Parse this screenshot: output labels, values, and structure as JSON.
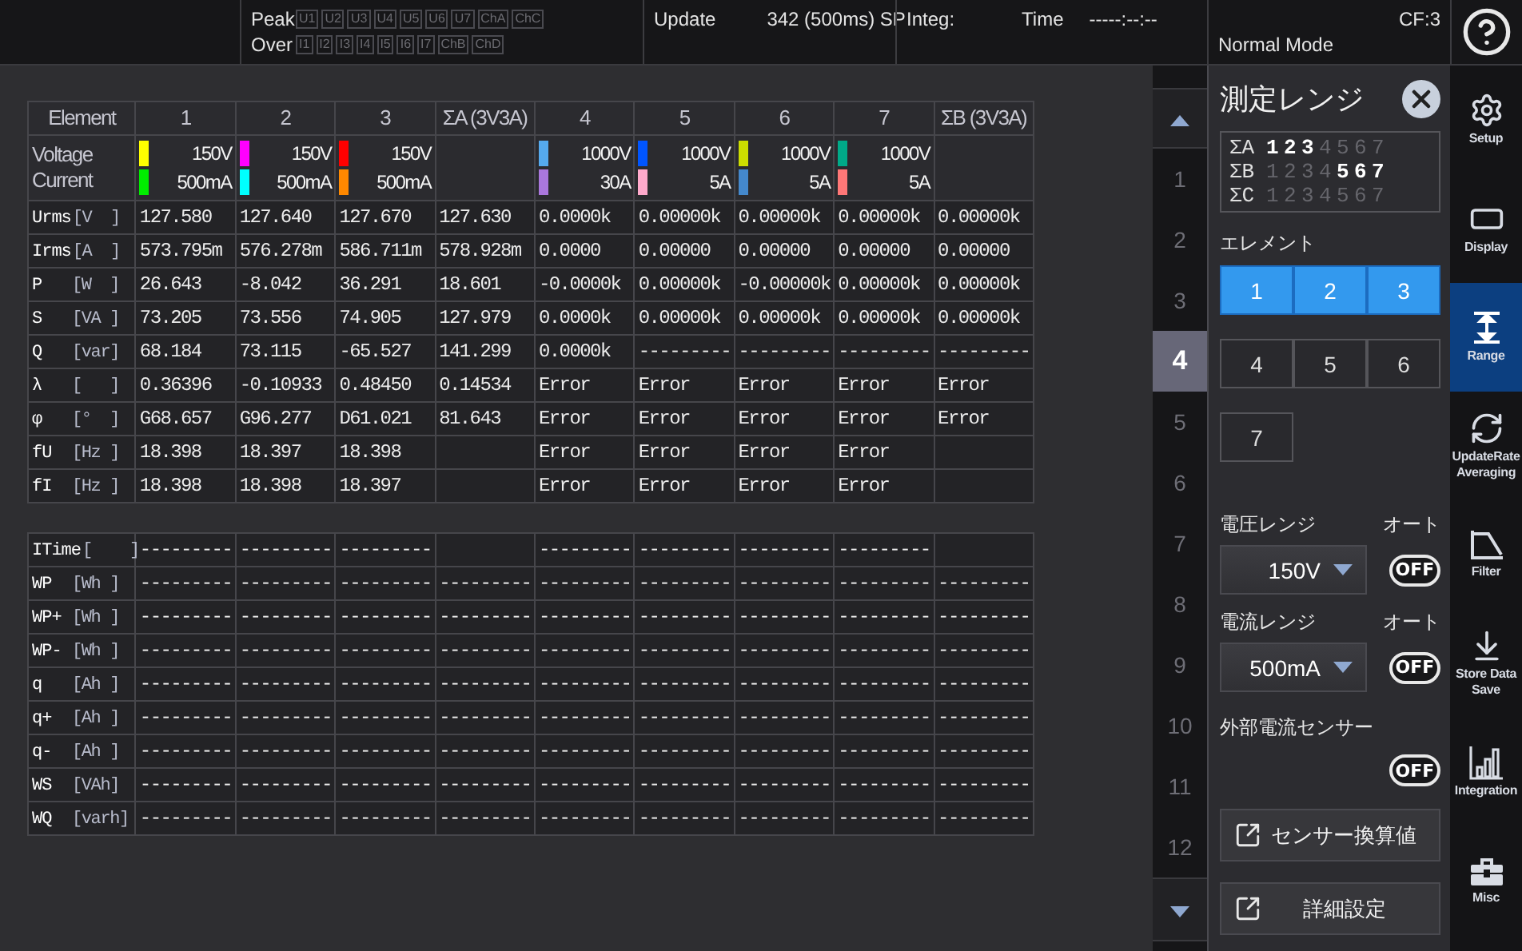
{
  "header": {
    "peak_label": "Peak",
    "peak_indicators": [
      "U1",
      "U2",
      "U3",
      "U4",
      "U5",
      "U6",
      "U7",
      "ChA",
      "ChC"
    ],
    "over_label": "Over",
    "over_indicators": [
      "I1",
      "I2",
      "I3",
      "I4",
      "I5",
      "I6",
      "I7",
      "ChB",
      "ChD"
    ],
    "update_label": "Update",
    "update_value": "342 (500ms) SP",
    "integ_label": "Integ:",
    "time_label": "Time",
    "time_value": "-----:--:--",
    "crest_factor": "CF:3",
    "mode": "Normal Mode"
  },
  "measurement_table": {
    "corner": "Element",
    "range_labels": [
      "Voltage",
      "Current"
    ],
    "columns": [
      {
        "label": "1",
        "voltage": {
          "range": "150V",
          "color": "#ffff00"
        },
        "current": {
          "range": "500mA",
          "color": "#00ee00"
        }
      },
      {
        "label": "2",
        "voltage": {
          "range": "150V",
          "color": "#ff00ff"
        },
        "current": {
          "range": "500mA",
          "color": "#00ffff"
        }
      },
      {
        "label": "3",
        "voltage": {
          "range": "150V",
          "color": "#ff0000"
        },
        "current": {
          "range": "500mA",
          "color": "#ff8800"
        }
      },
      {
        "label": "ΣA (3V3A)"
      },
      {
        "label": "4",
        "voltage": {
          "range": "1000V",
          "color": "#55aaee"
        },
        "current": {
          "range": "30A",
          "color": "#aa77dd"
        }
      },
      {
        "label": "5",
        "voltage": {
          "range": "1000V",
          "color": "#0055ff"
        },
        "current": {
          "range": "5A",
          "color": "#ffaacc"
        }
      },
      {
        "label": "6",
        "voltage": {
          "range": "1000V",
          "color": "#ccdd00"
        },
        "current": {
          "range": "5A",
          "color": "#4488cc"
        }
      },
      {
        "label": "7",
        "voltage": {
          "range": "1000V",
          "color": "#00aa88"
        },
        "current": {
          "range": "5A",
          "color": "#ff7777"
        }
      },
      {
        "label": "ΣB (3V3A)"
      }
    ],
    "rows": [
      {
        "function": "Urms",
        "unit": "[V  ]",
        "cells": [
          {
            "kind": "value",
            "text": "127.580"
          },
          {
            "kind": "value",
            "text": "127.640"
          },
          {
            "kind": "value",
            "text": "127.670"
          },
          {
            "kind": "value",
            "text": "127.630"
          },
          {
            "kind": "value",
            "text": "0.0000k"
          },
          {
            "kind": "value",
            "text": "0.00000k"
          },
          {
            "kind": "value",
            "text": "0.00000k"
          },
          {
            "kind": "value",
            "text": "0.00000k"
          },
          {
            "kind": "value",
            "text": "0.00000k"
          }
        ]
      },
      {
        "function": "Irms",
        "unit": "[A  ]",
        "cells": [
          {
            "kind": "value",
            "text": "573.795m"
          },
          {
            "kind": "value",
            "text": "576.278m"
          },
          {
            "kind": "value",
            "text": "586.711m"
          },
          {
            "kind": "value",
            "text": "578.928m"
          },
          {
            "kind": "value",
            "text": "0.0000"
          },
          {
            "kind": "value",
            "text": "0.00000"
          },
          {
            "kind": "value",
            "text": "0.00000"
          },
          {
            "kind": "value",
            "text": "0.00000"
          },
          {
            "kind": "value",
            "text": "0.00000"
          }
        ]
      },
      {
        "function": "P",
        "unit": "[W  ]",
        "cells": [
          {
            "kind": "value",
            "text": "26.643"
          },
          {
            "kind": "value",
            "text": "-8.042"
          },
          {
            "kind": "value",
            "text": "36.291"
          },
          {
            "kind": "value",
            "text": "18.601"
          },
          {
            "kind": "value",
            "text": "-0.0000k"
          },
          {
            "kind": "value",
            "text": "0.00000k"
          },
          {
            "kind": "value",
            "text": "-0.00000k"
          },
          {
            "kind": "value",
            "text": "0.00000k"
          },
          {
            "kind": "value",
            "text": "0.00000k"
          }
        ]
      },
      {
        "function": "S",
        "unit": "[VA ]",
        "cells": [
          {
            "kind": "value",
            "text": "73.205"
          },
          {
            "kind": "value",
            "text": "73.556"
          },
          {
            "kind": "value",
            "text": "74.905"
          },
          {
            "kind": "value",
            "text": "127.979"
          },
          {
            "kind": "value",
            "text": "0.0000k"
          },
          {
            "kind": "value",
            "text": "0.00000k"
          },
          {
            "kind": "value",
            "text": "0.00000k"
          },
          {
            "kind": "value",
            "text": "0.00000k"
          },
          {
            "kind": "value",
            "text": "0.00000k"
          }
        ]
      },
      {
        "function": "Q",
        "unit": "[var]",
        "cells": [
          {
            "kind": "value",
            "text": "68.184"
          },
          {
            "kind": "value",
            "text": "73.115"
          },
          {
            "kind": "value",
            "text": "-65.527"
          },
          {
            "kind": "value",
            "text": "141.299"
          },
          {
            "kind": "value",
            "text": "0.0000k"
          },
          {
            "kind": "value",
            "text": "---------"
          },
          {
            "kind": "value",
            "text": "---------"
          },
          {
            "kind": "value",
            "text": "---------"
          },
          {
            "kind": "value",
            "text": "---------"
          }
        ]
      },
      {
        "function": "λ",
        "unit": "[   ]",
        "cells": [
          {
            "kind": "value",
            "text": "0.36396"
          },
          {
            "kind": "value",
            "text": "-0.10933"
          },
          {
            "kind": "value",
            "text": "0.48450"
          },
          {
            "kind": "value",
            "text": "0.14534"
          },
          {
            "kind": "value",
            "text": "Error"
          },
          {
            "kind": "value",
            "text": "Error"
          },
          {
            "kind": "value",
            "text": "Error"
          },
          {
            "kind": "value",
            "text": "Error"
          },
          {
            "kind": "value",
            "text": "Error"
          }
        ]
      },
      {
        "function": "φ",
        "unit": "[°  ]",
        "cells": [
          {
            "kind": "value",
            "text": "G68.657"
          },
          {
            "kind": "value",
            "text": "G96.277"
          },
          {
            "kind": "value",
            "text": "D61.021"
          },
          {
            "kind": "value",
            "text": "81.643"
          },
          {
            "kind": "value",
            "text": "Error"
          },
          {
            "kind": "value",
            "text": "Error"
          },
          {
            "kind": "value",
            "text": "Error"
          },
          {
            "kind": "value",
            "text": "Error"
          },
          {
            "kind": "value",
            "text": "Error"
          }
        ]
      },
      {
        "function": "fU",
        "unit": "[Hz ]",
        "cells": [
          {
            "kind": "value",
            "text": "18.398"
          },
          {
            "kind": "value",
            "text": "18.397"
          },
          {
            "kind": "value",
            "text": "18.398"
          },
          {
            "kind": "blank"
          },
          {
            "kind": "value",
            "text": "Error"
          },
          {
            "kind": "value",
            "text": "Error"
          },
          {
            "kind": "value",
            "text": "Error"
          },
          {
            "kind": "value",
            "text": "Error"
          },
          {
            "kind": "blank"
          }
        ]
      },
      {
        "function": "fI",
        "unit": "[Hz ]",
        "cells": [
          {
            "kind": "value",
            "text": "18.398"
          },
          {
            "kind": "value",
            "text": "18.398"
          },
          {
            "kind": "value",
            "text": "18.397"
          },
          {
            "kind": "blank"
          },
          {
            "kind": "value",
            "text": "Error"
          },
          {
            "kind": "value",
            "text": "Error"
          },
          {
            "kind": "value",
            "text": "Error"
          },
          {
            "kind": "value",
            "text": "Error"
          },
          {
            "kind": "blank"
          }
        ]
      }
    ]
  },
  "integration_table": {
    "rows": [
      {
        "function": "ITime",
        "unit": "[    ]",
        "cells": [
          {
            "kind": "value",
            "text": "---------"
          },
          {
            "kind": "value",
            "text": "---------"
          },
          {
            "kind": "value",
            "text": "---------"
          },
          {
            "kind": "blank"
          },
          {
            "kind": "value",
            "text": "---------"
          },
          {
            "kind": "value",
            "text": "---------"
          },
          {
            "kind": "value",
            "text": "---------"
          },
          {
            "kind": "value",
            "text": "---------"
          },
          {
            "kind": "blank"
          }
        ]
      },
      {
        "function": "WP",
        "unit": "[Wh ]",
        "cells": [
          {
            "kind": "value",
            "text": "---------"
          },
          {
            "kind": "value",
            "text": "---------"
          },
          {
            "kind": "value",
            "text": "---------"
          },
          {
            "kind": "value",
            "text": "---------"
          },
          {
            "kind": "value",
            "text": "---------"
          },
          {
            "kind": "value",
            "text": "---------"
          },
          {
            "kind": "value",
            "text": "---------"
          },
          {
            "kind": "value",
            "text": "---------"
          },
          {
            "kind": "value",
            "text": "---------"
          }
        ]
      },
      {
        "function": "WP+",
        "unit": "[Wh ]",
        "cells": [
          {
            "kind": "value",
            "text": "---------"
          },
          {
            "kind": "value",
            "text": "---------"
          },
          {
            "kind": "value",
            "text": "---------"
          },
          {
            "kind": "value",
            "text": "---------"
          },
          {
            "kind": "value",
            "text": "---------"
          },
          {
            "kind": "value",
            "text": "---------"
          },
          {
            "kind": "value",
            "text": "---------"
          },
          {
            "kind": "value",
            "text": "---------"
          },
          {
            "kind": "value",
            "text": "---------"
          }
        ]
      },
      {
        "function": "WP-",
        "unit": "[Wh ]",
        "cells": [
          {
            "kind": "value",
            "text": "---------"
          },
          {
            "kind": "value",
            "text": "---------"
          },
          {
            "kind": "value",
            "text": "---------"
          },
          {
            "kind": "value",
            "text": "---------"
          },
          {
            "kind": "value",
            "text": "---------"
          },
          {
            "kind": "value",
            "text": "---------"
          },
          {
            "kind": "value",
            "text": "---------"
          },
          {
            "kind": "value",
            "text": "---------"
          },
          {
            "kind": "value",
            "text": "---------"
          }
        ]
      },
      {
        "function": "q",
        "unit": "[Ah ]",
        "cells": [
          {
            "kind": "value",
            "text": "---------"
          },
          {
            "kind": "value",
            "text": "---------"
          },
          {
            "kind": "value",
            "text": "---------"
          },
          {
            "kind": "value",
            "text": "---------"
          },
          {
            "kind": "value",
            "text": "---------"
          },
          {
            "kind": "value",
            "text": "---------"
          },
          {
            "kind": "value",
            "text": "---------"
          },
          {
            "kind": "value",
            "text": "---------"
          },
          {
            "kind": "value",
            "text": "---------"
          }
        ]
      },
      {
        "function": "q+",
        "unit": "[Ah ]",
        "cells": [
          {
            "kind": "value",
            "text": "---------"
          },
          {
            "kind": "value",
            "text": "---------"
          },
          {
            "kind": "value",
            "text": "---------"
          },
          {
            "kind": "value",
            "text": "---------"
          },
          {
            "kind": "value",
            "text": "---------"
          },
          {
            "kind": "value",
            "text": "---------"
          },
          {
            "kind": "value",
            "text": "---------"
          },
          {
            "kind": "value",
            "text": "---------"
          },
          {
            "kind": "value",
            "text": "---------"
          }
        ]
      },
      {
        "function": "q-",
        "unit": "[Ah ]",
        "cells": [
          {
            "kind": "value",
            "text": "---------"
          },
          {
            "kind": "value",
            "text": "---------"
          },
          {
            "kind": "value",
            "text": "---------"
          },
          {
            "kind": "value",
            "text": "---------"
          },
          {
            "kind": "value",
            "text": "---------"
          },
          {
            "kind": "value",
            "text": "---------"
          },
          {
            "kind": "value",
            "text": "---------"
          },
          {
            "kind": "value",
            "text": "---------"
          },
          {
            "kind": "value",
            "text": "---------"
          }
        ]
      },
      {
        "function": "WS",
        "unit": "[VAh]",
        "cells": [
          {
            "kind": "value",
            "text": "---------"
          },
          {
            "kind": "value",
            "text": "---------"
          },
          {
            "kind": "value",
            "text": "---------"
          },
          {
            "kind": "value",
            "text": "---------"
          },
          {
            "kind": "value",
            "text": "---------"
          },
          {
            "kind": "value",
            "text": "---------"
          },
          {
            "kind": "value",
            "text": "---------"
          },
          {
            "kind": "value",
            "text": "---------"
          },
          {
            "kind": "value",
            "text": "---------"
          }
        ]
      },
      {
        "function": "WQ",
        "unit": "[varh]",
        "cells": [
          {
            "kind": "value",
            "text": "---------"
          },
          {
            "kind": "value",
            "text": "---------"
          },
          {
            "kind": "value",
            "text": "---------"
          },
          {
            "kind": "value",
            "text": "---------"
          },
          {
            "kind": "value",
            "text": "---------"
          },
          {
            "kind": "value",
            "text": "---------"
          },
          {
            "kind": "value",
            "text": "---------"
          },
          {
            "kind": "value",
            "text": "---------"
          },
          {
            "kind": "value",
            "text": "---------"
          }
        ]
      }
    ]
  },
  "pages": {
    "items": [
      {
        "label": "1",
        "selected": false
      },
      {
        "label": "2",
        "selected": false
      },
      {
        "label": "3",
        "selected": false
      },
      {
        "label": "4",
        "selected": true
      },
      {
        "label": "5",
        "selected": false
      },
      {
        "label": "6",
        "selected": false
      },
      {
        "label": "7",
        "selected": false
      },
      {
        "label": "8",
        "selected": false
      },
      {
        "label": "9",
        "selected": false
      },
      {
        "label": "10",
        "selected": false
      },
      {
        "label": "11",
        "selected": false
      },
      {
        "label": "12",
        "selected": false
      }
    ]
  },
  "panel": {
    "title": "測定レンジ",
    "wiring": [
      {
        "label": "ΣA",
        "elements": [
          {
            "label": "1",
            "active": true
          },
          {
            "label": "2",
            "active": true
          },
          {
            "label": "3",
            "active": true
          },
          {
            "label": "4",
            "active": false
          },
          {
            "label": "5",
            "active": false
          },
          {
            "label": "6",
            "active": false
          },
          {
            "label": "7",
            "active": false
          }
        ]
      },
      {
        "label": "ΣB",
        "elements": [
          {
            "label": "1",
            "active": false
          },
          {
            "label": "2",
            "active": false
          },
          {
            "label": "3",
            "active": false
          },
          {
            "label": "4",
            "active": false
          },
          {
            "label": "5",
            "active": true
          },
          {
            "label": "6",
            "active": true
          },
          {
            "label": "7",
            "active": true
          }
        ]
      },
      {
        "label": "ΣC",
        "elements": [
          {
            "label": "1",
            "active": false
          },
          {
            "label": "2",
            "active": false
          },
          {
            "label": "3",
            "active": false
          },
          {
            "label": "4",
            "active": false
          },
          {
            "label": "5",
            "active": false
          },
          {
            "label": "6",
            "active": false
          },
          {
            "label": "7",
            "active": false
          }
        ]
      }
    ],
    "element_label": "エレメント",
    "elements": [
      {
        "label": "1",
        "selected": true
      },
      {
        "label": "2",
        "selected": true
      },
      {
        "label": "3",
        "selected": true
      },
      {
        "label": "4",
        "selected": false
      },
      {
        "label": "5",
        "selected": false
      },
      {
        "label": "6",
        "selected": false
      },
      {
        "label": "7",
        "selected": false
      }
    ],
    "voltage_range": {
      "label": "電圧レンジ",
      "auto_label": "オート",
      "value": "150V",
      "auto": {
        "label": "OFF",
        "on": false
      }
    },
    "current_range": {
      "label": "電流レンジ",
      "auto_label": "オート",
      "value": "500mA",
      "auto": {
        "label": "OFF",
        "on": false
      }
    },
    "external_sensor": {
      "label": "外部電流センサー",
      "toggle": {
        "label": "OFF",
        "on": false
      }
    },
    "buttons": [
      "センサー換算値",
      "詳細設定"
    ]
  },
  "sidebar": [
    {
      "kind": "gear",
      "label": "Setup",
      "selected": false
    },
    {
      "kind": "display",
      "label": "Display",
      "selected": false
    },
    {
      "kind": "range",
      "label": "Range",
      "selected": true
    },
    {
      "kind": "update",
      "label": "UpdateRate Averaging",
      "selected": false
    },
    {
      "kind": "filter",
      "label": "Filter",
      "selected": false
    },
    {
      "kind": "store",
      "label": "Store Data Save",
      "selected": false
    },
    {
      "kind": "integration",
      "label": "Integration",
      "selected": false
    },
    {
      "kind": "misc",
      "label": "Misc",
      "selected": false
    }
  ]
}
